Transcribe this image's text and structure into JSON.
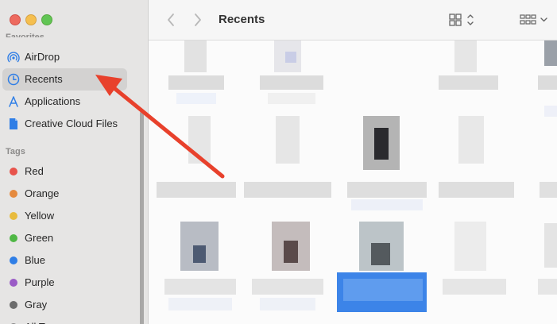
{
  "window": {
    "traffic_lights": {
      "close_color": "#ed6a5e",
      "minimize_color": "#f5bf4f",
      "maximize_color": "#61c554"
    }
  },
  "sidebar": {
    "favorites_header": "Favorites",
    "favorites": [
      {
        "label": "AirDrop",
        "icon": "airdrop-icon",
        "selected": false
      },
      {
        "label": "Recents",
        "icon": "clock-icon",
        "selected": true
      },
      {
        "label": "Applications",
        "icon": "applications-icon",
        "selected": false
      },
      {
        "label": "Creative Cloud Files",
        "icon": "document-icon",
        "selected": false
      }
    ],
    "tags_header": "Tags",
    "tags": [
      {
        "label": "Red",
        "color": "#e8534b"
      },
      {
        "label": "Orange",
        "color": "#e58a3f"
      },
      {
        "label": "Yellow",
        "color": "#e8bb3d"
      },
      {
        "label": "Green",
        "color": "#4fb745"
      },
      {
        "label": "Blue",
        "color": "#2f7ee6"
      },
      {
        "label": "Purple",
        "color": "#9a5bc6"
      },
      {
        "label": "Gray",
        "color": "#6d6d6d"
      },
      {
        "label": "All Tags…",
        "color": "#8a8a8a"
      }
    ]
  },
  "toolbar": {
    "title": "Recents",
    "back_icon": "chevron-left-icon",
    "forward_icon": "chevron-right-icon",
    "view_mode_icon": "icon-grid-view-icon",
    "group_icon": "group-by-icon"
  },
  "annotation": {
    "arrow_color": "#e8412c",
    "points_to": "Recents"
  }
}
